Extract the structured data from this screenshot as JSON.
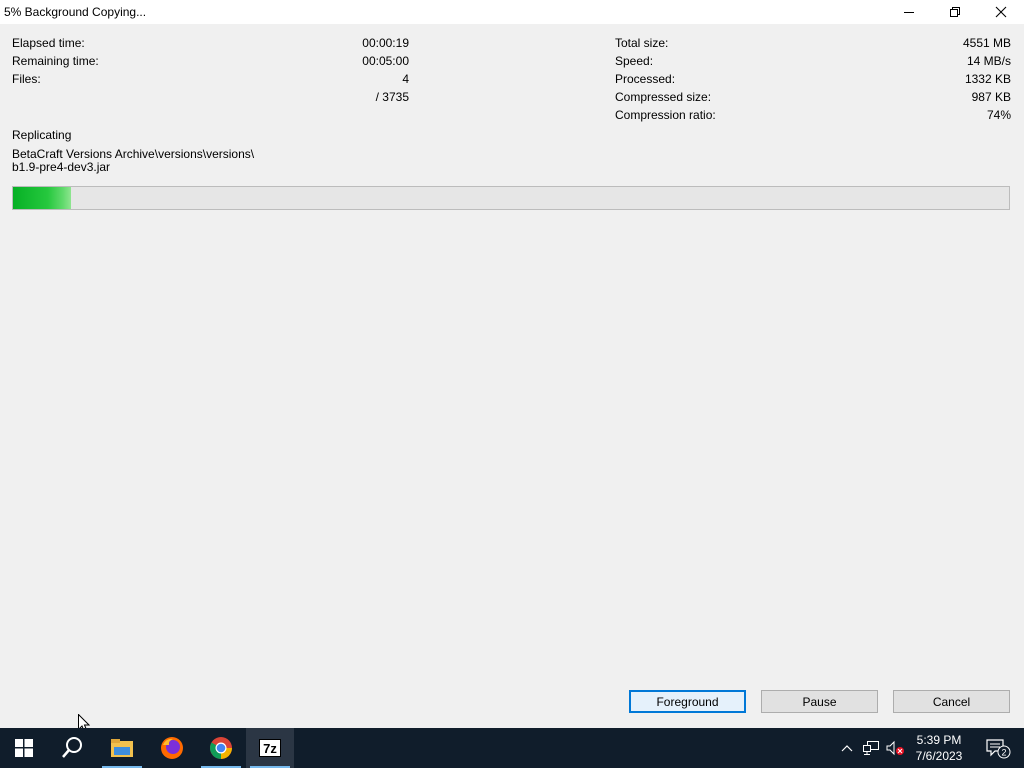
{
  "window": {
    "title": "5% Background Copying..."
  },
  "stats_left": {
    "elapsed_label": "Elapsed time:",
    "elapsed_value": "00:00:19",
    "remaining_label": "Remaining time:",
    "remaining_value": "00:05:00",
    "files_label": "Files:",
    "files_value": "4",
    "files_total": "/ 3735"
  },
  "stats_right": {
    "total_size_label": "Total size:",
    "total_size_value": "4551 MB",
    "speed_label": "Speed:",
    "speed_value": "14 MB/s",
    "processed_label": "Processed:",
    "processed_value": "1332 KB",
    "compressed_label": "Compressed size:",
    "compressed_value": "987 KB",
    "ratio_label": "Compression ratio:",
    "ratio_value": "74%"
  },
  "operation": {
    "stage": "Replicating",
    "path_line1": "BetaCraft Versions Archive\\versions\\versions\\",
    "path_line2": "b1.9-pre4-dev3.jar",
    "progress_percent": 5
  },
  "buttons": {
    "foreground": "Foreground",
    "pause": "Pause",
    "cancel": "Cancel"
  },
  "taskbar": {
    "apps": [
      "start-icon",
      "search-icon",
      "file-explorer-icon",
      "firefox-icon",
      "chrome-icon",
      "7zip-icon"
    ],
    "seven_zip_label": "7z",
    "clock_time": "5:39 PM",
    "clock_date": "7/6/2023",
    "notification_count": "2"
  },
  "colors": {
    "progress_green": "#06b025",
    "accent": "#0078d7",
    "taskbar": "#101d2b"
  }
}
